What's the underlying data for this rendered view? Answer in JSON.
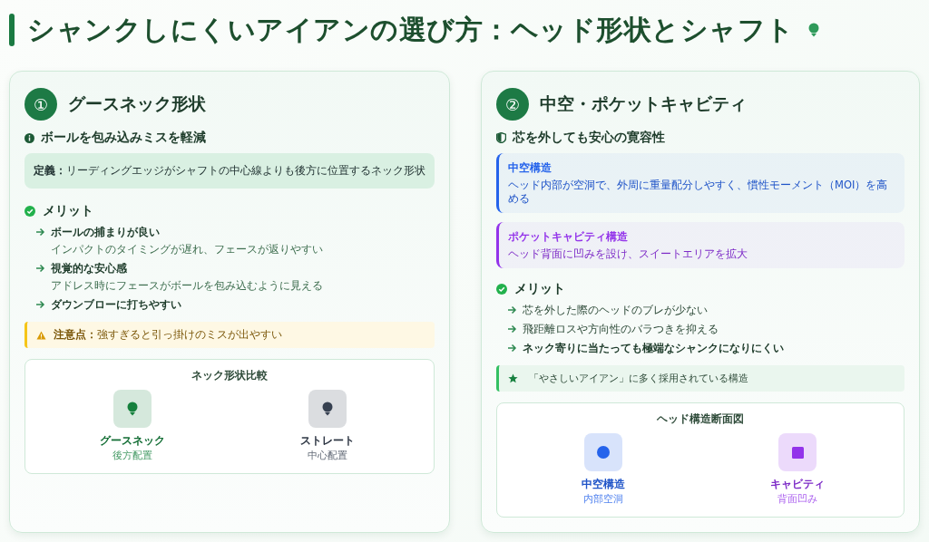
{
  "title": "シャンクしにくいアイアンの選び方：ヘッド形状とシャフト",
  "cards": [
    {
      "number": "①",
      "title": "グースネック形状",
      "subtitle": {
        "text": "ボールを包み込みミスを軽減"
      },
      "blocks": [
        {
          "kind": "definition",
          "label": "定義：",
          "text": "リーディングエッジがシャフトの中心線よりも後方に位置するネック形状"
        },
        {
          "kind": "merits",
          "heading": "メリット",
          "items": [
            {
              "title": "ボールの捕まりが良い",
              "detail": "インパクトのタイミングが遅れ、フェースが返りやすい",
              "emphasis": true
            },
            {
              "title": "視覚的な安心感",
              "detail": "アドレス時にフェースがボールを包み込むように見える",
              "emphasis": true
            },
            {
              "title": "ダウンブローに打ちやすい",
              "emphasis": true
            }
          ]
        },
        {
          "kind": "warning",
          "label": "注意点：",
          "text": "強すぎると引っ掛けのミスが出やすい"
        },
        {
          "kind": "diagram",
          "heading": "ネック形状比較",
          "items": [
            {
              "kind": "tee",
              "color": "#15803d",
              "name": "グースネック",
              "caption": "後方配置"
            },
            {
              "kind": "tee",
              "color": "#374151",
              "name": "ストレート",
              "caption": "中心配置"
            }
          ]
        }
      ]
    },
    {
      "number": "②",
      "title": "中空・ポケットキャビティ",
      "subtitle": {
        "text": "芯を外しても安心の寛容性"
      },
      "blocks": [
        {
          "kind": "structure",
          "color": "#2563eb",
          "title": "中空構造",
          "text": "ヘッド内部が空洞で、外周に重量配分しやすく、慣性モーメント（MOI）を高める"
        },
        {
          "kind": "structure",
          "color": "#9333ea",
          "title": "ポケットキャビティ構造",
          "text": "ヘッド背面に凹みを設け、スイートエリアを拡大"
        },
        {
          "kind": "merits",
          "heading": "メリット",
          "items": [
            {
              "title": "芯を外した際のヘッドのブレが少ない",
              "emphasis": false
            },
            {
              "title": "飛距離ロスや方向性のバラつきを抑える",
              "emphasis": false
            },
            {
              "title": "ネック寄りに当たっても極端なシャンクになりにくい",
              "emphasis": true
            }
          ]
        },
        {
          "kind": "note",
          "text": "「やさしいアイアン」に多く採用されている構造"
        },
        {
          "kind": "diagram",
          "heading": "ヘッド構造断面図",
          "items": [
            {
              "kind": "circle",
              "color": "#2563eb",
              "name": "中空構造",
              "caption": "内部空洞"
            },
            {
              "kind": "square",
              "color": "#9333ea",
              "name": "キャビティ",
              "caption": "背面凹み"
            }
          ]
        }
      ]
    }
  ]
}
